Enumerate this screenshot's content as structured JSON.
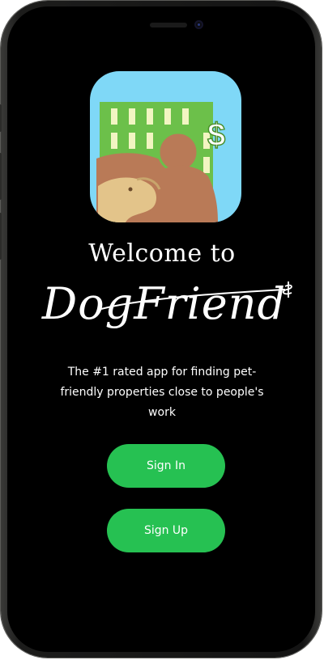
{
  "welcome": {
    "line1": "Welcome to",
    "brand": "DogFriend"
  },
  "tagline": "The #1 rated app for finding pet-friendly properties close to people's work",
  "buttons": {
    "sign_in": "Sign In",
    "sign_up": "Sign Up"
  },
  "app_icon": {
    "currency_symbol": "$"
  },
  "colors": {
    "screen_background": "#000000",
    "button_green": "#26c152",
    "icon_sky": "#7fd8f7",
    "icon_building": "#6cc04a",
    "icon_window": "#f2f5c2",
    "icon_dog_brown": "#b97a57",
    "icon_dog_tan": "#e3c48a"
  }
}
